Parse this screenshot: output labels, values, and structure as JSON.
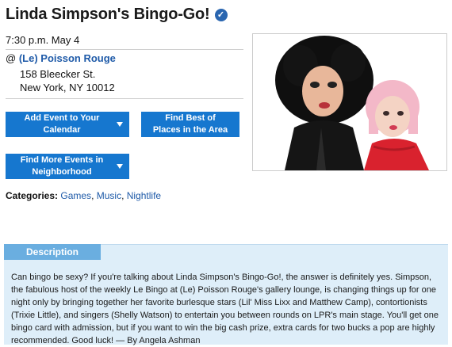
{
  "event": {
    "title": "Linda Simpson's Bingo-Go!",
    "verified_icon": "check-badge-icon",
    "verified_glyph": "✓",
    "time": "7:30 p.m. May 4",
    "venue_prefix": "@",
    "venue": "(Le) Poisson Rouge",
    "address_line1": "158 Bleecker St.",
    "address_line2": "New York, NY 10012"
  },
  "buttons": {
    "add_calendar": "Add Event to Your Calendar",
    "best_places": "Find Best of Places in the Area",
    "more_events": "Find More Events in Neighborhood"
  },
  "categories": {
    "label": "Categories:",
    "items": [
      "Games",
      "Music",
      "Nightlife"
    ]
  },
  "description": {
    "tab_label": "Description",
    "text": "Can bingo be sexy? If you're talking about Linda Simpson's Bingo-Go!, the answer is definitely yes. Simpson, the fabulous host of the weekly Le Bingo at (Le) Poisson Rouge's gallery lounge, is changing things up for one night only by bringing together her favorite burlesque stars (Lil' Miss Lixx and Matthew Camp), contortionists (Trixie Little), and singers (Shelly Watson) to entertain you between rounds on LPR's main stage. You'll get one bingo card with admission, but if you want to win the big cash prize, extra cards for two bucks a pop are highly recommended. Good luck! — By Angela Ashman"
  },
  "colors": {
    "button_blue": "#1677cf",
    "link_blue": "#1e5aa8",
    "panel_bg": "#deeef9",
    "tab_bg": "#6aaee0"
  }
}
